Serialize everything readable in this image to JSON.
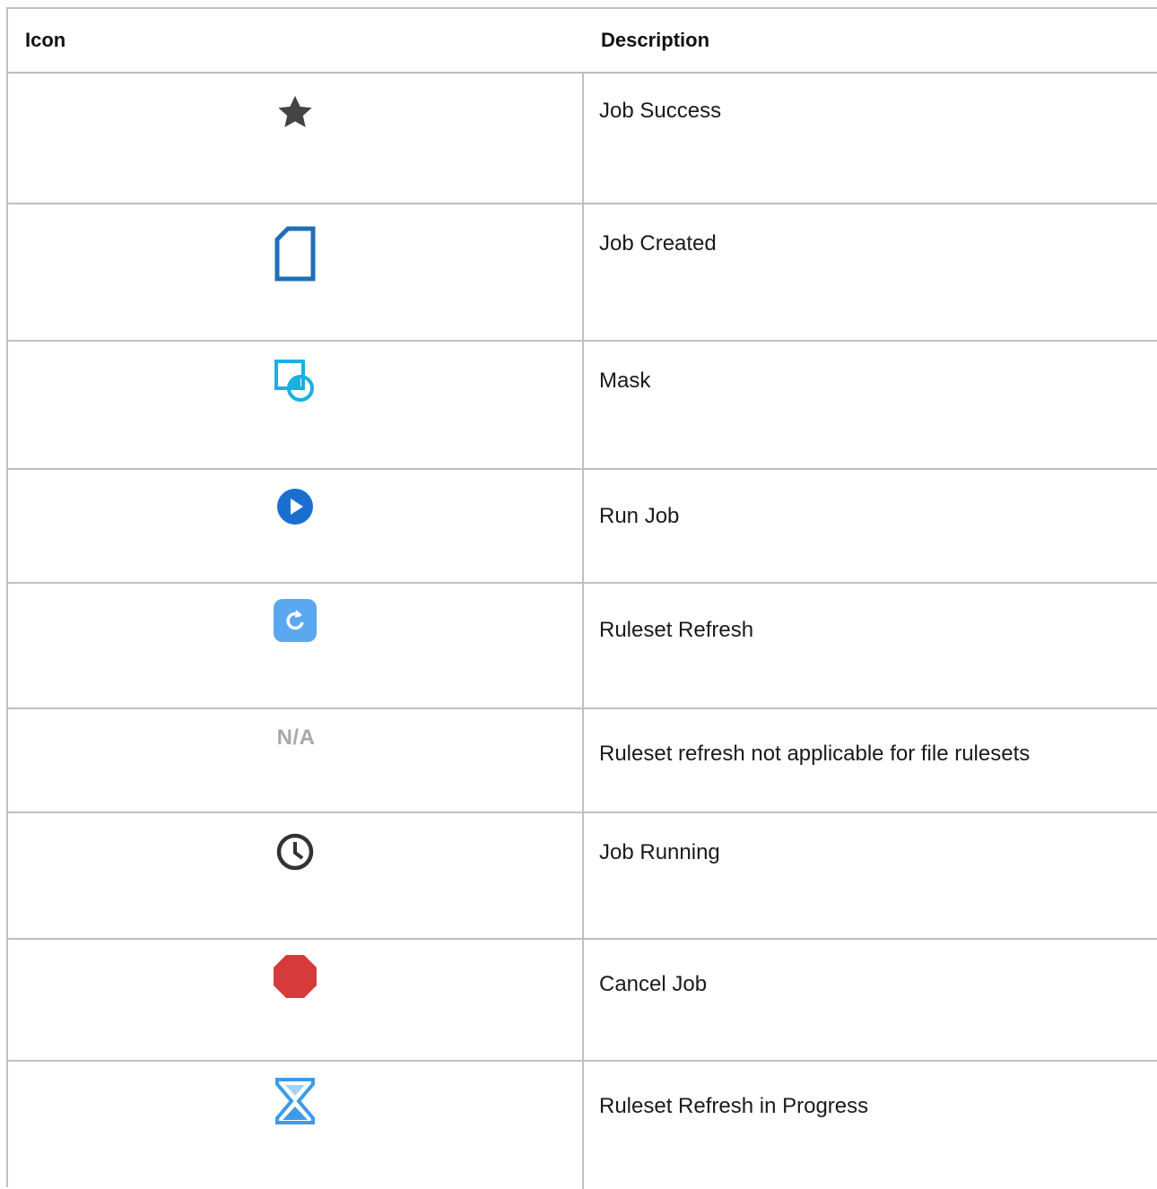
{
  "table": {
    "headers": {
      "icon": "Icon",
      "description": "Description"
    },
    "rows": [
      {
        "icon": "star-icon",
        "icon_color": "#444444",
        "description": "Job Success"
      },
      {
        "icon": "document-icon",
        "icon_color": "#1f6fb5",
        "description": "Job Created"
      },
      {
        "icon": "mask-icon",
        "icon_color": "#1ab0e0",
        "description": "Mask"
      },
      {
        "icon": "play-circle-icon",
        "icon_color": "#1a6fd0",
        "description": "Run Job"
      },
      {
        "icon": "refresh-icon",
        "icon_color": "#5aa8f0",
        "description": "Ruleset Refresh"
      },
      {
        "icon": "na-text-icon",
        "icon_text": "N/A",
        "icon_color": "#a8a8a8",
        "description": "Ruleset refresh not applicable for file rulesets"
      },
      {
        "icon": "clock-icon",
        "icon_color": "#333333",
        "description": "Job Running"
      },
      {
        "icon": "stop-octagon-icon",
        "icon_color": "#d63a3a",
        "description": "Cancel Job"
      },
      {
        "icon": "hourglass-icon",
        "icon_color": "#3d9be9",
        "description": "Ruleset Refresh in Progress"
      }
    ]
  }
}
